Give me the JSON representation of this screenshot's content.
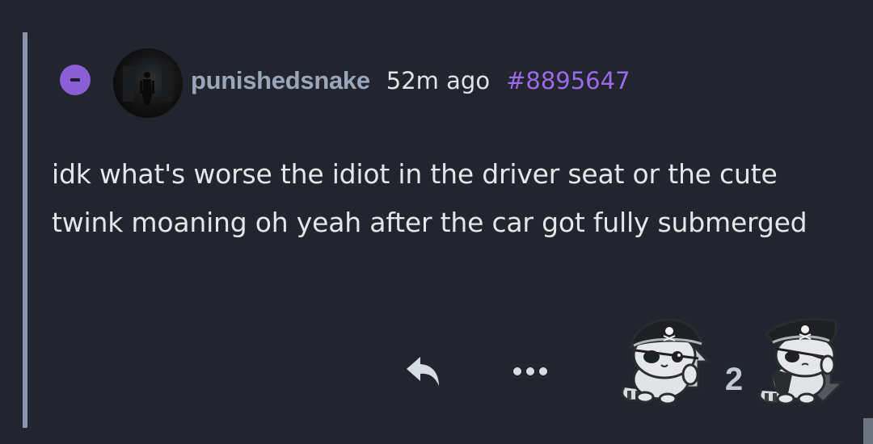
{
  "comment": {
    "collapse_icon": "minus-icon",
    "avatar_icon": "user-avatar",
    "username": "punishedsnake",
    "timestamp": "52m ago",
    "post_id": "#8895647",
    "body": "idk what's worse the idiot in the driver seat or the cute twink moaning oh yeah after the car got fully submerged"
  },
  "actions": {
    "reply_icon": "reply-arrow-icon",
    "more_icon": "ellipsis-icon",
    "upvote_icon": "pirate-cat-upvote-icon",
    "downvote_icon": "pirate-cat-downvote-icon",
    "score": "2"
  },
  "colors": {
    "background": "#22252d",
    "thread_line": "#8b97ad",
    "accent": "#8a5fd6",
    "username": "#9aa7bb",
    "post_id": "#9a6be8",
    "text": "#e3e6ec"
  }
}
